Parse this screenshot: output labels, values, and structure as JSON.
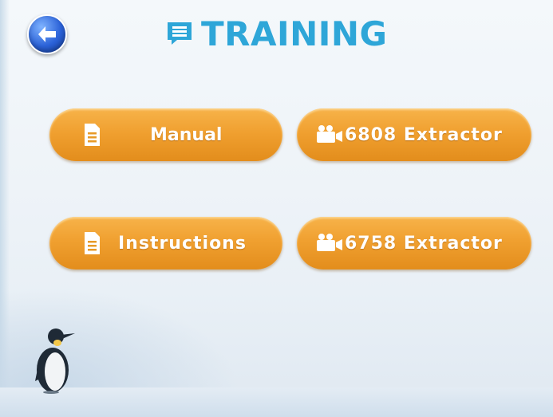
{
  "header": {
    "title": "TRAINING",
    "icon": "chat-list-icon"
  },
  "nav": {
    "back_icon": "back-arrow-icon"
  },
  "buttons": {
    "manual": {
      "label": "Manual",
      "icon": "document-icon"
    },
    "extractor_6808": {
      "label": "6808 Extractor",
      "icon": "video-camera-icon"
    },
    "instructions": {
      "label": "Instructions",
      "icon": "document-icon"
    },
    "extractor_6758": {
      "label": "6758 Extractor",
      "icon": "video-camera-icon"
    }
  },
  "colors": {
    "title": "#2ea6d8",
    "button": "#f0a030",
    "back_button": "#2b62d8"
  }
}
